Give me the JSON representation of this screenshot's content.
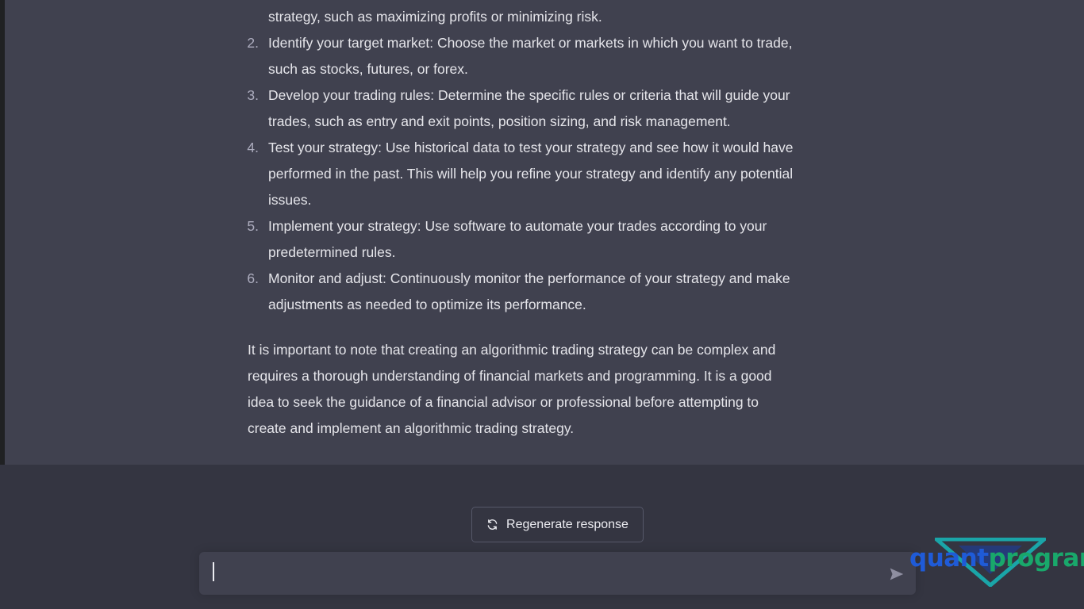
{
  "message": {
    "first_line_continuation": "strategy, such as maximizing profits or minimizing risk.",
    "items": [
      {
        "num": "2.",
        "lines": [
          "Identify your target market: Choose the market or markets in which you want to trade,",
          "such as stocks, futures, or forex."
        ]
      },
      {
        "num": "3.",
        "lines": [
          "Develop your trading rules: Determine the specific rules or criteria that will guide your",
          "trades, such as entry and exit points, position sizing, and risk management."
        ]
      },
      {
        "num": "4.",
        "lines": [
          "Test your strategy: Use historical data to test your strategy and see how it would have",
          "performed in the past. This will help you refine your strategy and identify any potential",
          "issues."
        ]
      },
      {
        "num": "5.",
        "lines": [
          "Implement your strategy: Use software to automate your trades according to your",
          "predetermined rules."
        ]
      },
      {
        "num": "6.",
        "lines": [
          "Monitor and adjust: Continuously monitor the performance of your strategy and make",
          "adjustments as needed to optimize its performance."
        ]
      }
    ],
    "closing_paragraph": [
      "It is important to note that creating an algorithmic trading strategy can be complex and",
      "requires a thorough understanding of financial markets and programming. It is a good",
      "idea to seek the guidance of a financial advisor or professional before attempting to",
      "create and implement an algorithmic trading strategy."
    ]
  },
  "composer": {
    "regenerate_label": "Regenerate response",
    "regenerate_icon": "refresh-icon",
    "input_value": "",
    "input_placeholder": "",
    "send_icon": "send-icon"
  },
  "watermark": {
    "part1": "quant",
    "part2": "program"
  },
  "colors": {
    "message_bg": "#40414f",
    "page_bg": "#343541",
    "logo_blue": "#1f5bd8",
    "logo_green": "#19a86b"
  }
}
